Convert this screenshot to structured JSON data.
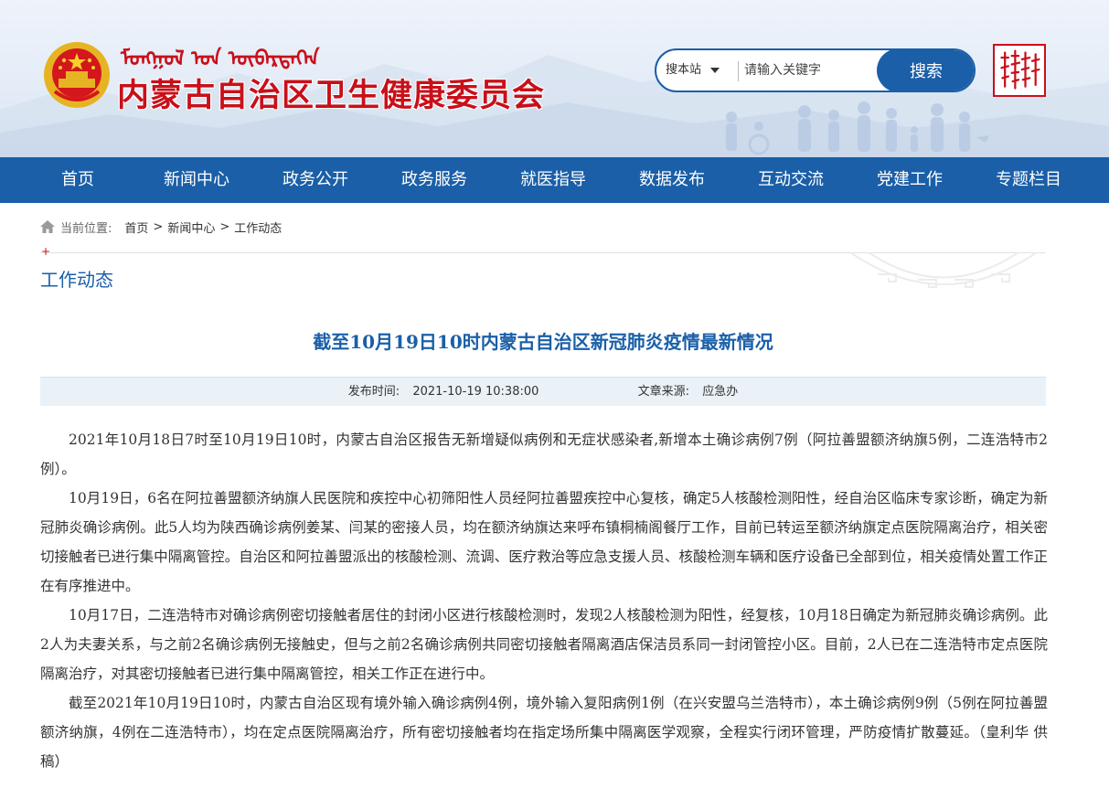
{
  "header": {
    "site_title": "内蒙古自治区卫生健康委员会",
    "mongolian_script": "ᠮᠣᠩᠭᠣᠯ ᠤᠨ ᠥᠪᠡᠷᠲᠡᠭᠡᠨ",
    "search": {
      "scope_label": "搜本站",
      "placeholder": "请输入关键字",
      "button_label": "搜索"
    },
    "colors": {
      "brand_red": "#c8101a",
      "brand_blue": "#1a5fa8"
    }
  },
  "nav": {
    "items": [
      "首页",
      "新闻中心",
      "政务公开",
      "政务服务",
      "就医指导",
      "数据发布",
      "互动交流",
      "党建工作",
      "专题栏目"
    ]
  },
  "breadcrumb": {
    "label": "当前位置:",
    "items": [
      "首页",
      "新闻中心",
      "工作动态"
    ],
    "separator": ">"
  },
  "section": {
    "title": "工作动态",
    "marker": "+"
  },
  "article": {
    "title": "截至10月19日10时内蒙古自治区新冠肺炎疫情最新情况",
    "publish_label": "发布时间:",
    "publish_time": "2021-10-19 10:38:00",
    "source_label": "文章来源:",
    "source": "应急办",
    "paragraphs": [
      "2021年10月18日7时至10月19日10时，内蒙古自治区报告无新增疑似病例和无症状感染者,新增本土确诊病例7例（阿拉善盟额济纳旗5例，二连浩特市2例）。",
      "10月19日，6名在阿拉善盟额济纳旗人民医院和疾控中心初筛阳性人员经阿拉善盟疾控中心复核，确定5人核酸检测阳性，经自治区临床专家诊断，确定为新冠肺炎确诊病例。此5人均为陕西确诊病例姜某、闫某的密接人员，均在额济纳旗达来呼布镇桐楠阁餐厅工作，目前已转运至额济纳旗定点医院隔离治疗，相关密切接触者已进行集中隔离管控。自治区和阿拉善盟派出的核酸检测、流调、医疗救治等应急支援人员、核酸检测车辆和医疗设备已全部到位，相关疫情处置工作正在有序推进中。",
      "10月17日，二连浩特市对确诊病例密切接触者居住的封闭小区进行核酸检测时，发现2人核酸检测为阳性，经复核，10月18日确定为新冠肺炎确诊病例。此2人为夫妻关系，与之前2名确诊病例无接触史，但与之前2名确诊病例共同密切接触者隔离酒店保洁员系同一封闭管控小区。目前，2人已在二连浩特市定点医院隔离治疗，对其密切接触者已进行集中隔离管控，相关工作正在进行中。",
      "截至2021年10月19日10时，内蒙古自治区现有境外输入确诊病例4例，境外输入复阳病例1例（在兴安盟乌兰浩特市），本土确诊病例9例（5例在阿拉善盟额济纳旗，4例在二连浩特市），均在定点医院隔离治疗，所有密切接触者均在指定场所集中隔离医学观察，全程实行闭环管理，严防疫情扩散蔓延。（皇利华 供稿）"
    ]
  }
}
